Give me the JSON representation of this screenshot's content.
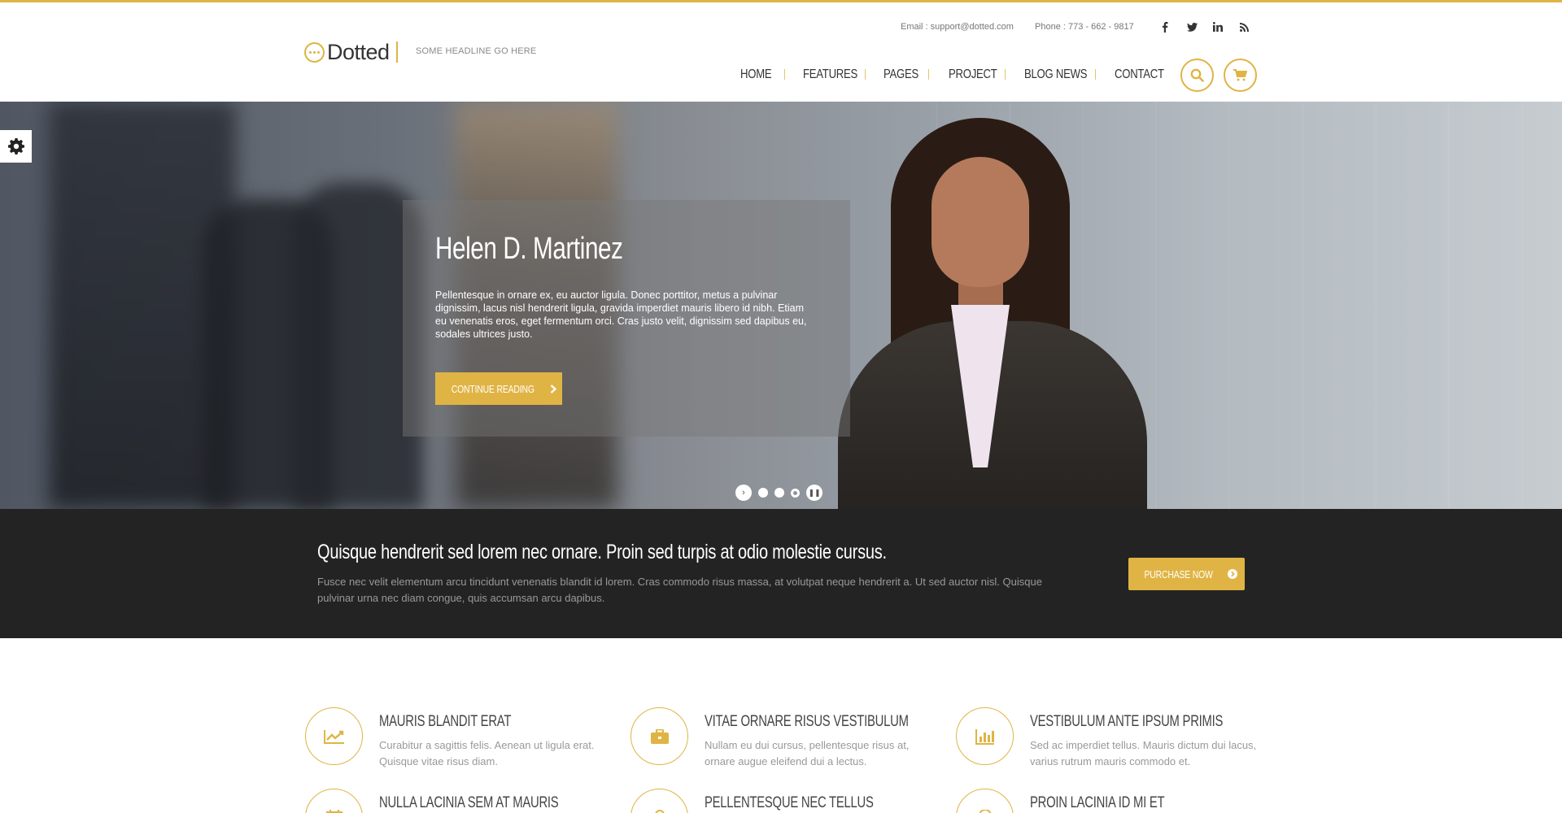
{
  "header": {
    "brand": "Dotted",
    "tagline": "SOME HEADLINE GO HERE",
    "email": "Email : support@dotted.com",
    "phone": "Phone : 773 - 662 - 9817",
    "social_icons": [
      "facebook-icon",
      "twitter-icon",
      "linkedin-icon",
      "rss-icon"
    ],
    "nav": [
      "HOME",
      "FEATURES",
      "PAGES",
      "PROJECT",
      "BLOG NEWS",
      "CONTACT"
    ],
    "accent_color": "#e0b444"
  },
  "hero": {
    "title": "Helen D. Martinez",
    "text": "Pellentesque in ornare ex, eu auctor ligula. Donec porttitor, metus a pulvinar dignissim, lacus nisl hendrerit ligula, gravida imperdiet mauris libero id nibh. Etiam eu venenatis eros, eget fermentum orci. Cras justo velit, dignissim sed dapibus eu, sodales ultrices justo.",
    "button": "CONTINUE READING",
    "active_slide": 3
  },
  "band": {
    "title": "Quisque hendrerit sed lorem nec ornare. Proin sed turpis at odio molestie cursus.",
    "text": "Fusce nec velit elementum arcu tincidunt venenatis blandit id lorem. Cras commodo risus massa, at volutpat neque hendrerit a. Ut sed auctor nisl. Quisque pulvinar urna nec diam congue, quis accumsan arcu dapibus.",
    "button": "PURCHASE NOW",
    "background": "#232323"
  },
  "features": [
    {
      "title": "MAURIS BLANDIT ERAT",
      "text": "Curabitur a sagittis felis. Aenean ut ligula erat. Quisque vitae risus diam.",
      "icon": "line-chart-icon"
    },
    {
      "title": "VITAE ORNARE RISUS VESTIBULUM",
      "text": "Nullam eu dui cursus, pellentesque risus at, ornare augue eleifend dui a lectus.",
      "icon": "briefcase-icon"
    },
    {
      "title": "VESTIBULUM ANTE IPSUM PRIMIS",
      "text": "Sed ac imperdiet tellus. Mauris dictum dui lacus, varius rutrum mauris commodo et.",
      "icon": "bar-chart-icon"
    },
    {
      "title": "NULLA LACINIA SEM AT MAURIS",
      "text": "",
      "icon": "calendar-icon"
    },
    {
      "title": "PELLENTESQUE NEC TELLUS",
      "text": "",
      "icon": "lock-icon"
    },
    {
      "title": "PROIN LACINIA ID MI ET",
      "text": "",
      "icon": "location-icon"
    }
  ]
}
